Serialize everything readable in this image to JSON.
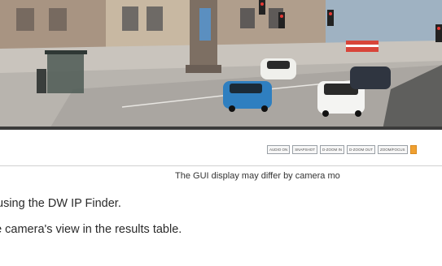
{
  "toolbar": {
    "buttons": [
      "AUDIO ON",
      "SNAPSHOT",
      "D-ZOOM IN",
      "D-ZOOM OUT",
      "ZOOM/FOCUS"
    ]
  },
  "caption": "The GUI display may differ by camera mo",
  "steps": [
    "using the DW IP Finder.",
    "he camera's view in the results table."
  ],
  "colors": {
    "sky": "#8fa7b8",
    "road": "#c9c4bd",
    "accent_button": "#f0a030"
  }
}
